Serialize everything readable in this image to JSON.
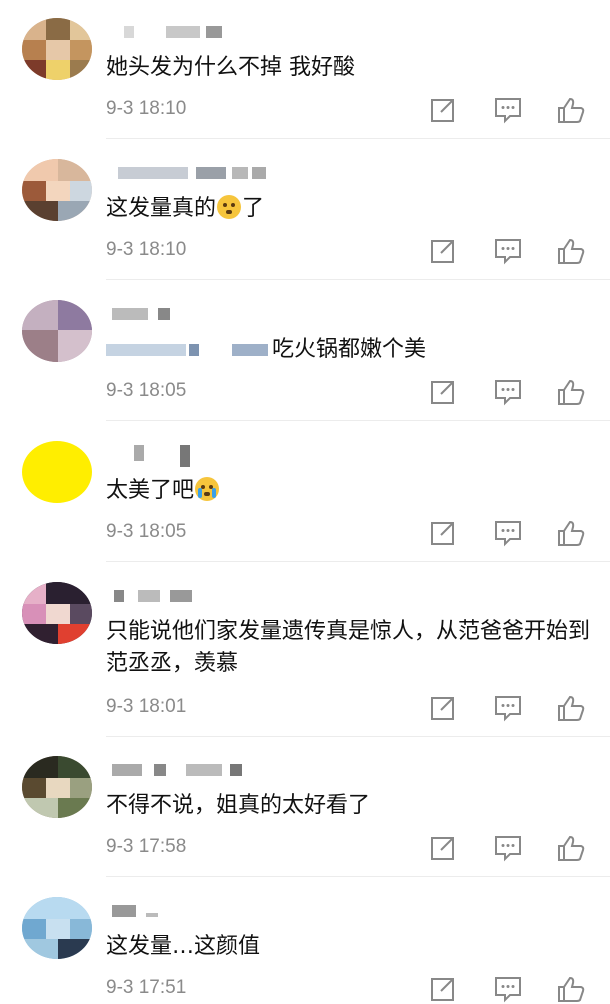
{
  "comments": [
    {
      "text": "她头发为什么不掉 我好酸",
      "time": "9-3 18:10"
    },
    {
      "text_before": "这发量真的",
      "emoji": "shy-face-emoji",
      "text_after": "了",
      "time": "9-3 18:10"
    },
    {
      "text": "吃火锅都嫩个美",
      "time": "9-3 18:05"
    },
    {
      "text": "太美了吧",
      "emoji": "crying-face-emoji",
      "time": "9-3 18:05"
    },
    {
      "text": "只能说他们家发量遗传真是惊人，从范爸爸开始到范丞丞，羡慕",
      "time": "9-3 18:01"
    },
    {
      "text": "不得不说，姐真的太好看了",
      "time": "9-3 17:58"
    },
    {
      "text": "这发量…这颜值",
      "time": "9-3 17:51"
    }
  ],
  "colors": {
    "timestamp": "#8a8a8a",
    "divider": "#ececec",
    "avatar_yellow": "#ffee00"
  }
}
